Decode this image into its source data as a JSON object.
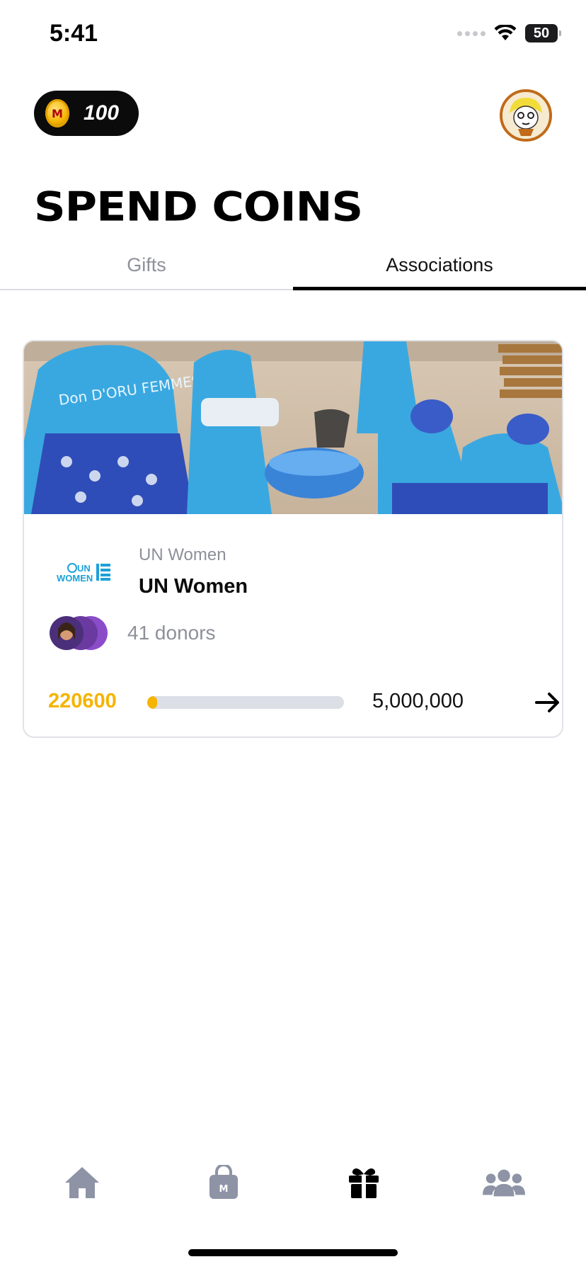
{
  "status_bar": {
    "time": "5:41",
    "battery": "50"
  },
  "wallet": {
    "coins": "100",
    "coin_glyph": "M"
  },
  "header": {
    "title": "SPEND COINS"
  },
  "tabs": [
    {
      "label": "Gifts",
      "active": false
    },
    {
      "label": "Associations",
      "active": true
    }
  ],
  "association_card": {
    "org_subtitle": "UN Women",
    "org_name": "UN Women",
    "logo_text": "UN WOMEN",
    "donors": "41 donors",
    "raised": "220600",
    "goal": "5,000,000",
    "progress_fraction": 0.04412
  },
  "nav": {
    "items": [
      "home-icon",
      "shop-bag-icon",
      "gift-icon",
      "community-icon"
    ],
    "active": "gift-icon"
  },
  "colors": {
    "accent": "#f5b400",
    "muted": "#8e9099",
    "nav_inactive": "#8e93a6",
    "nav_active": "#000000"
  }
}
